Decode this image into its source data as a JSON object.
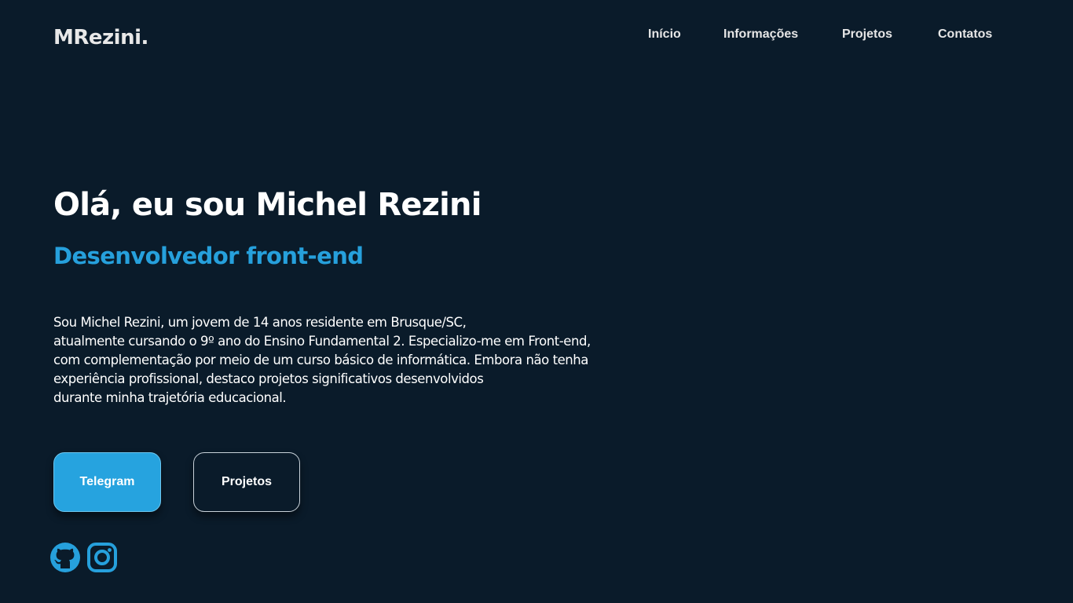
{
  "header": {
    "logo": "MRezini.",
    "nav": [
      {
        "label": "Início"
      },
      {
        "label": "Informações"
      },
      {
        "label": "Projetos"
      },
      {
        "label": "Contatos"
      }
    ]
  },
  "hero": {
    "title": "Olá, eu sou Michel Rezini",
    "subtitle": "Desenvolvedor front-end",
    "bio_lines": [
      "Sou Michel Rezini, um jovem de 14 anos residente em Brusque/SC,",
      "atualmente cursando o 9º ano do Ensino Fundamental 2. Especializo-me em Front-end,",
      "com complementação por meio de um curso básico de informática. Embora não tenha",
      "experiência profissional, destaco projetos significativos desenvolvidos",
      "durante minha trajetória educacional."
    ],
    "buttons": {
      "telegram": "Telegram",
      "projetos": "Projetos"
    }
  },
  "social": {
    "icons": [
      "github-icon",
      "instagram-icon"
    ]
  },
  "colors": {
    "background": "#0a1b2a",
    "accent": "#26a0dc",
    "text": "#ffffff"
  }
}
